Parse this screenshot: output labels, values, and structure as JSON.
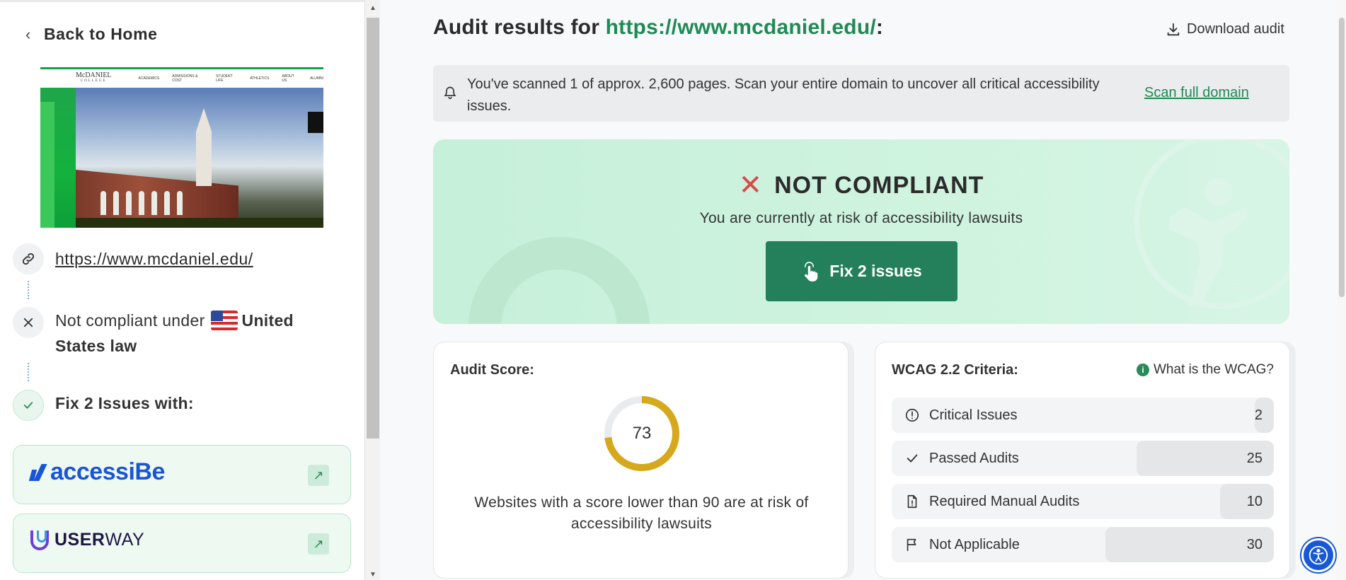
{
  "sidebar": {
    "back_label": "Back to Home",
    "url": "https://www.mcdaniel.edu/",
    "status_prefix": "Not compliant under",
    "status_country": "United States law",
    "fix_with_label": "Fix 2 Issues with:",
    "vendors": [
      {
        "name": "accessiBe"
      },
      {
        "name_bold": "USER",
        "name_light": "WAY"
      }
    ],
    "thumbnail": {
      "logo_top": "McDANIEL",
      "logo_bottom": "COLLEGE",
      "nav": [
        "ACADEMICS",
        "ADMISSIONS & COST",
        "STUDENT LIFE",
        "ATHLETICS",
        "ABOUT US",
        "ALUMNI"
      ]
    }
  },
  "main": {
    "title_prefix": "Audit results for",
    "title_url": "https://www.mcdaniel.edu/",
    "title_suffix": ":",
    "download_label": "Download audit",
    "banner": {
      "message": "You've scanned 1 of approx. 2,600 pages. Scan your entire domain to uncover all critical accessibility issues.",
      "cta": "Scan full domain"
    },
    "hero": {
      "status": "NOT COMPLIANT",
      "subtitle": "You are currently at risk of accessibility lawsuits",
      "button": "Fix 2 issues"
    },
    "score_card": {
      "title": "Audit Score:",
      "score": 73,
      "note": "Websites with a score lower than 90 are at risk of accessibility lawsuits"
    },
    "wcag_card": {
      "title": "WCAG 2.2 Criteria:",
      "info_label": "What is the WCAG?",
      "rows": [
        {
          "label": "Critical Issues",
          "value": "2",
          "icon": "alert-circle-icon",
          "share": 0.05
        },
        {
          "label": "Passed Audits",
          "value": "25",
          "icon": "check-icon",
          "share": 0.36
        },
        {
          "label": "Required Manual Audits",
          "value": "10",
          "icon": "document-icon",
          "share": 0.14
        },
        {
          "label": "Not Applicable",
          "value": "30",
          "icon": "flag-icon",
          "share": 0.44
        }
      ]
    }
  },
  "colors": {
    "accent_green": "#1f8a55",
    "button_green": "#24805a",
    "hero_bg": "#c6f0da",
    "gauge": "#d6a81c",
    "error_red": "#d94a4a"
  }
}
